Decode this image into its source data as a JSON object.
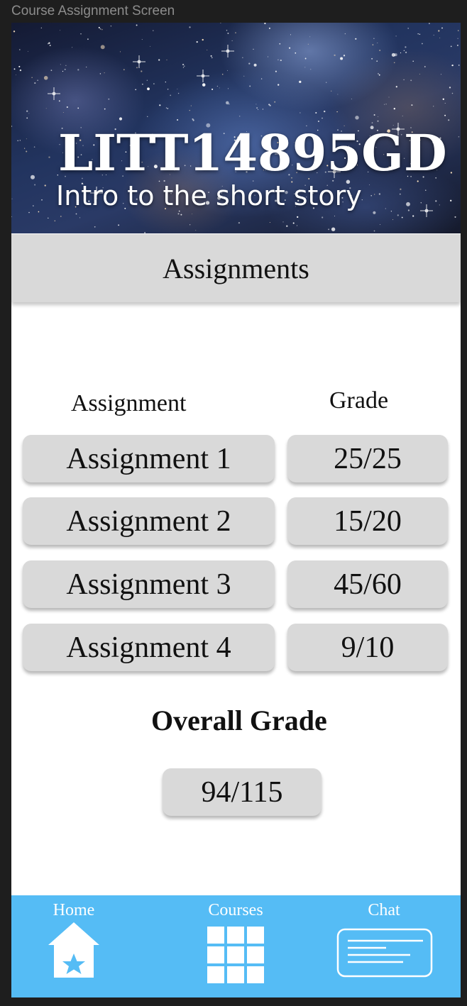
{
  "window": {
    "title": "Course Assignment Screen"
  },
  "course": {
    "code": "LITT14895GD",
    "name": "Intro to the short story"
  },
  "section": {
    "title": "Assignments"
  },
  "table": {
    "headers": {
      "assignment": "Assignment",
      "grade": "Grade"
    },
    "rows": [
      {
        "name": "Assignment 1",
        "grade": "25/25"
      },
      {
        "name": "Assignment 2",
        "grade": "15/20"
      },
      {
        "name": "Assignment 3",
        "grade": "45/60"
      },
      {
        "name": "Assignment 4",
        "grade": "9/10"
      }
    ]
  },
  "overall": {
    "label": "Overall Grade",
    "value": "94/115"
  },
  "tabbar": {
    "tabs": [
      {
        "label": "Home",
        "icon": "home-star-icon"
      },
      {
        "label": "Courses",
        "icon": "grid-icon"
      },
      {
        "label": "Chat",
        "icon": "chat-icon"
      }
    ]
  },
  "colors": {
    "tabbar": "#55bcf5",
    "pill": "#d9d9d9",
    "header": "#d9d9d9"
  }
}
